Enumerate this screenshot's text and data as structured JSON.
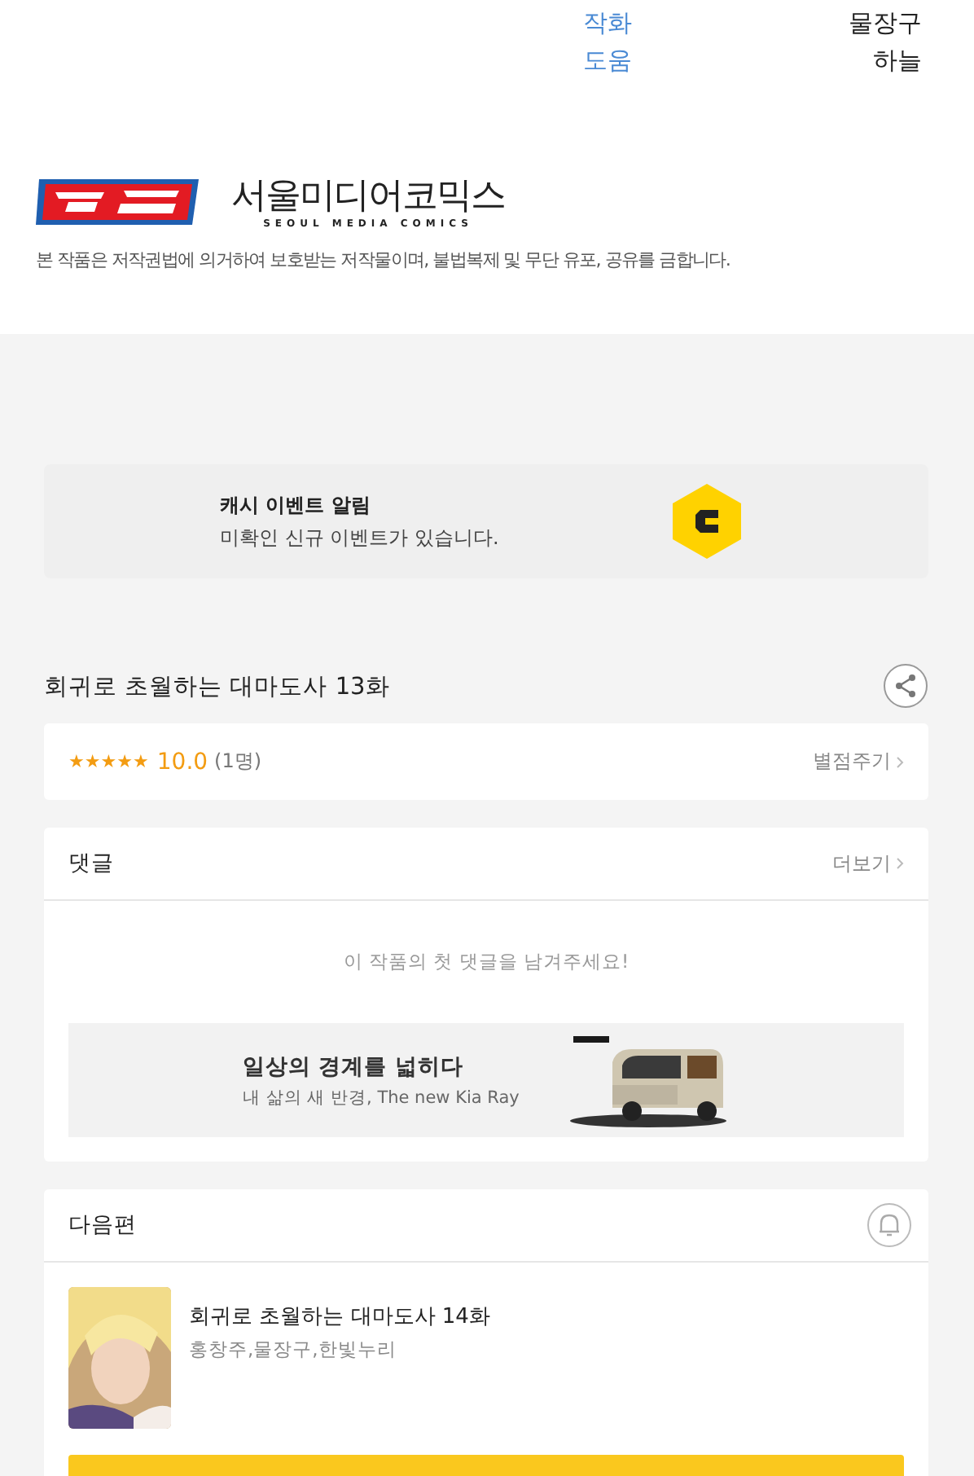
{
  "credits": [
    {
      "role": "작화",
      "name": "물장구"
    },
    {
      "role": "도움",
      "name": "하늘"
    }
  ],
  "publisher": {
    "name": "서울미디어코믹스",
    "subtitle": "SEOUL MEDIA COMICS",
    "notice": "본 작품은 저작권법에 의거하여 보호받는 저작물이며, 불법복제 및 무단 유포, 공유를 금합니다."
  },
  "cash_event": {
    "title": "캐시 이벤트 알림",
    "message": "미확인 신규 이벤트가 있습니다."
  },
  "episode": {
    "title": "회귀로 초월하는 대마도사 13화"
  },
  "rating": {
    "stars": 5,
    "score": "10.0",
    "count": "(1명)",
    "action": "별점주기"
  },
  "comments": {
    "title": "댓글",
    "more": "더보기",
    "empty": "이 작품의 첫 댓글을 남겨주세요!"
  },
  "ad": {
    "headline": "일상의 경계를 넓히다",
    "tagline": "내 삶의 새 반경, The new Kia Ray"
  },
  "next": {
    "title": "다음편",
    "episode_title": "회귀로 초월하는 대마도사 14화",
    "authors": "홍창주,물장구,한빛누리"
  }
}
